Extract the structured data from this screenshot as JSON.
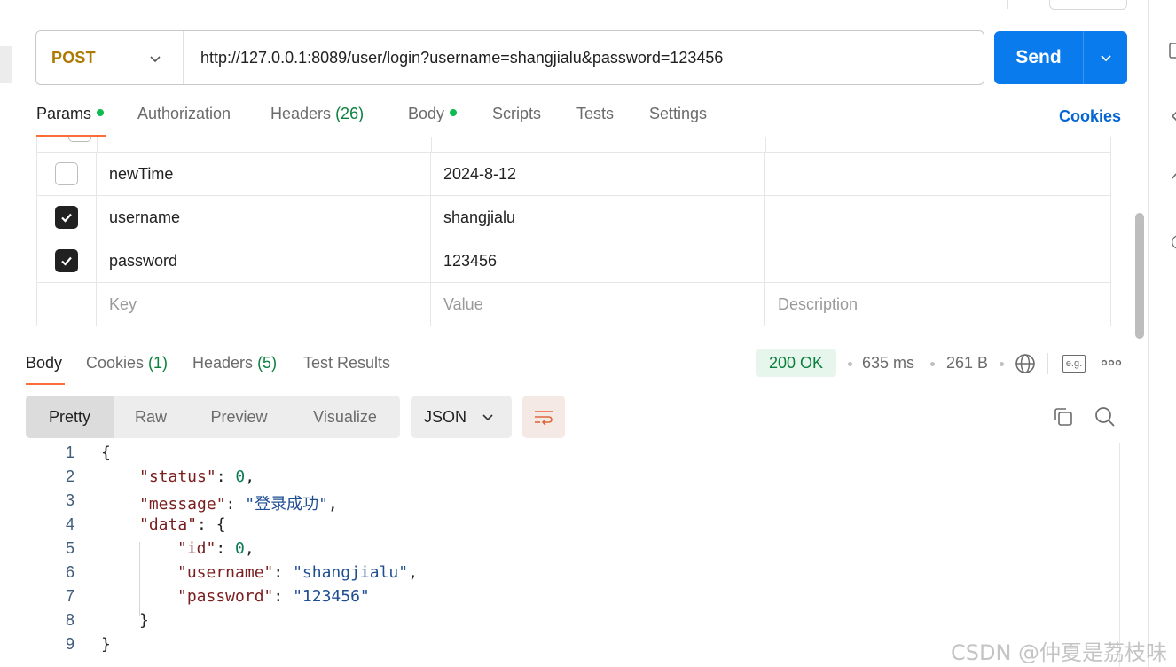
{
  "request": {
    "method": "POST",
    "url": "http://127.0.0.1:8089/user/login?username=shangjialu&password=123456",
    "send_label": "Send"
  },
  "request_tabs": [
    {
      "label": "Params",
      "count": "",
      "dot": true
    },
    {
      "label": "Authorization",
      "count": "",
      "dot": false
    },
    {
      "label": "Headers",
      "count": "(26)",
      "dot": false
    },
    {
      "label": "Body",
      "count": "",
      "dot": true
    },
    {
      "label": "Scripts",
      "count": "",
      "dot": false
    },
    {
      "label": "Tests",
      "count": "",
      "dot": false
    },
    {
      "label": "Settings",
      "count": "",
      "dot": false
    }
  ],
  "cookies_link": "Cookies",
  "params": {
    "rows": [
      {
        "checked": false,
        "key": "newTime",
        "value": "2024-8-12",
        "description": ""
      },
      {
        "checked": true,
        "key": "username",
        "value": "shangjialu",
        "description": ""
      },
      {
        "checked": true,
        "key": "password",
        "value": "123456",
        "description": ""
      }
    ],
    "placeholders": {
      "key": "Key",
      "value": "Value",
      "description": "Description"
    }
  },
  "response_tabs": [
    {
      "label": "Body",
      "count": ""
    },
    {
      "label": "Cookies",
      "count": "(1)"
    },
    {
      "label": "Headers",
      "count": "(5)"
    },
    {
      "label": "Test Results",
      "count": ""
    }
  ],
  "response_meta": {
    "status": "200 OK",
    "time": "635 ms",
    "size": "261 B",
    "example_icon_label": "e.g."
  },
  "format_tabs": [
    "Pretty",
    "Raw",
    "Preview",
    "Visualize"
  ],
  "language": "JSON",
  "code_lines": [
    {
      "n": "1",
      "indent": 0,
      "parts": [
        [
          "p",
          "{"
        ]
      ]
    },
    {
      "n": "2",
      "indent": 1,
      "parts": [
        [
          "k",
          "\"status\""
        ],
        [
          "p",
          ": "
        ],
        [
          "n",
          "0"
        ],
        [
          "p",
          ","
        ]
      ]
    },
    {
      "n": "3",
      "indent": 1,
      "parts": [
        [
          "k",
          "\"message\""
        ],
        [
          "p",
          ": "
        ],
        [
          "s",
          "\"登录成功\""
        ],
        [
          "p",
          ","
        ]
      ]
    },
    {
      "n": "4",
      "indent": 1,
      "parts": [
        [
          "k",
          "\"data\""
        ],
        [
          "p",
          ": {"
        ]
      ]
    },
    {
      "n": "5",
      "indent": 2,
      "parts": [
        [
          "k",
          "\"id\""
        ],
        [
          "p",
          ": "
        ],
        [
          "n",
          "0"
        ],
        [
          "p",
          ","
        ]
      ]
    },
    {
      "n": "6",
      "indent": 2,
      "parts": [
        [
          "k",
          "\"username\""
        ],
        [
          "p",
          ": "
        ],
        [
          "s",
          "\"shangjialu\""
        ],
        [
          "p",
          ","
        ]
      ]
    },
    {
      "n": "7",
      "indent": 2,
      "parts": [
        [
          "k",
          "\"password\""
        ],
        [
          "p",
          ": "
        ],
        [
          "s",
          "\"123456\""
        ]
      ]
    },
    {
      "n": "8",
      "indent": 1,
      "parts": [
        [
          "p",
          "}"
        ]
      ]
    },
    {
      "n": "9",
      "indent": 0,
      "parts": [
        [
          "p",
          "}"
        ]
      ]
    }
  ],
  "watermark": "CSDN @仲夏是荔枝味",
  "colors": {
    "accent": "#ff6c37",
    "send": "#097bed",
    "method": "#ad7a03",
    "success": "#0b7f3e"
  }
}
